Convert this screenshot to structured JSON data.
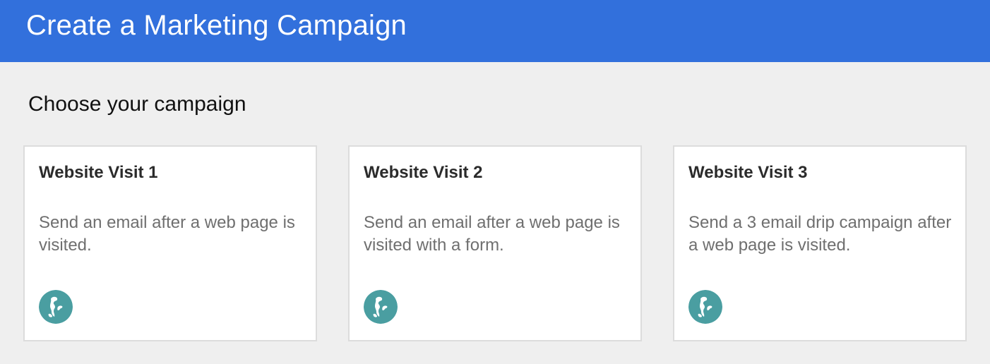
{
  "header": {
    "title": "Create a Marketing Campaign"
  },
  "main": {
    "section_title": "Choose your campaign",
    "cards": [
      {
        "title": "Website Visit 1",
        "description": "Send an email after a web page is visited.",
        "icon": "globe-icon"
      },
      {
        "title": "Website Visit 2",
        "description": "Send an email after a web page is visited with a form.",
        "icon": "globe-icon"
      },
      {
        "title": "Website Visit 3",
        "description": "Send a 3 email drip campaign after a web page is visited.",
        "icon": "globe-icon"
      }
    ]
  },
  "colors": {
    "header_background": "#3270dc",
    "page_background": "#efefef",
    "card_background": "#ffffff",
    "card_border": "#dcdcdc",
    "icon_circle": "#4a9ea1"
  }
}
